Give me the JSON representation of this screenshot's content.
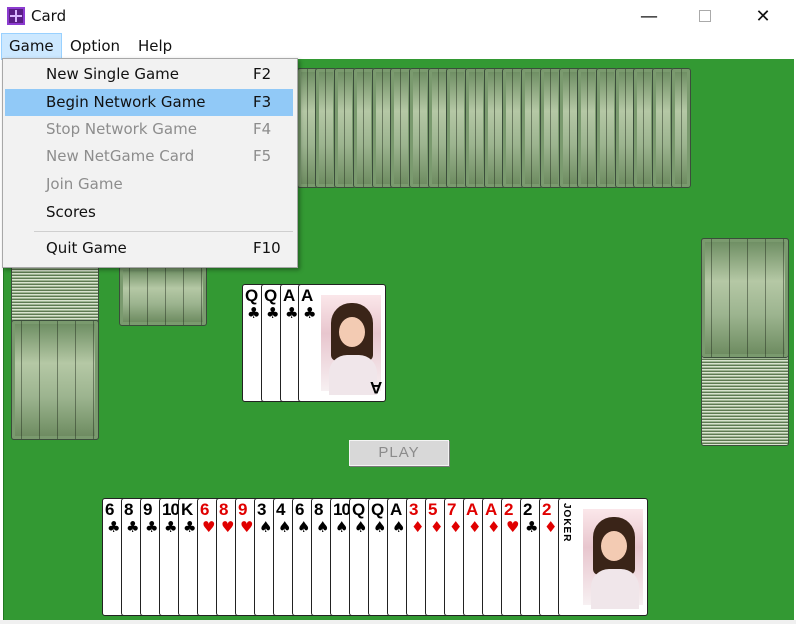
{
  "window": {
    "title": "Card",
    "controls": [
      "minimize-icon",
      "maximize-icon",
      "close-icon"
    ]
  },
  "menu": {
    "items": [
      "Game",
      "Option",
      "Help"
    ],
    "active": "Game",
    "dropdown": [
      {
        "label": "New Single Game",
        "shortcut": "F2",
        "state": "enabled"
      },
      {
        "label": "Begin Network Game",
        "shortcut": "F3",
        "state": "highlighted"
      },
      {
        "label": "Stop Network Game",
        "shortcut": "F4",
        "state": "disabled"
      },
      {
        "label": "New NetGame Card",
        "shortcut": "F5",
        "state": "disabled"
      },
      {
        "label": "Join Game",
        "shortcut": "",
        "state": "disabled"
      },
      {
        "label": "Scores",
        "shortcut": "",
        "state": "enabled"
      },
      {
        "label": "Quit Game",
        "shortcut": "F10",
        "state": "enabled"
      }
    ]
  },
  "table": {
    "background": "#339933"
  },
  "played_cards": [
    {
      "rank": "Q",
      "suit": "♣",
      "color": "black"
    },
    {
      "rank": "Q",
      "suit": "♣",
      "color": "black"
    },
    {
      "rank": "A",
      "suit": "♣",
      "color": "black"
    },
    {
      "rank": "A",
      "suit": "♣",
      "color": "black"
    }
  ],
  "play_button": {
    "label": "PLAY"
  },
  "hand": [
    {
      "rank": "6",
      "suit": "♣",
      "color": "black"
    },
    {
      "rank": "8",
      "suit": "♣",
      "color": "black"
    },
    {
      "rank": "9",
      "suit": "♣",
      "color": "black"
    },
    {
      "rank": "10",
      "suit": "♣",
      "color": "black"
    },
    {
      "rank": "K",
      "suit": "♣",
      "color": "black"
    },
    {
      "rank": "6",
      "suit": "♥",
      "color": "red"
    },
    {
      "rank": "8",
      "suit": "♥",
      "color": "red"
    },
    {
      "rank": "9",
      "suit": "♥",
      "color": "red"
    },
    {
      "rank": "3",
      "suit": "♠",
      "color": "black"
    },
    {
      "rank": "4",
      "suit": "♠",
      "color": "black"
    },
    {
      "rank": "6",
      "suit": "♠",
      "color": "black"
    },
    {
      "rank": "8",
      "suit": "♠",
      "color": "black"
    },
    {
      "rank": "10",
      "suit": "♠",
      "color": "black"
    },
    {
      "rank": "Q",
      "suit": "♠",
      "color": "black"
    },
    {
      "rank": "Q",
      "suit": "♠",
      "color": "black"
    },
    {
      "rank": "A",
      "suit": "♠",
      "color": "black"
    },
    {
      "rank": "3",
      "suit": "♦",
      "color": "red"
    },
    {
      "rank": "5",
      "suit": "♦",
      "color": "red"
    },
    {
      "rank": "7",
      "suit": "♦",
      "color": "red"
    },
    {
      "rank": "A",
      "suit": "♦",
      "color": "red"
    },
    {
      "rank": "A",
      "suit": "♦",
      "color": "red"
    },
    {
      "rank": "2",
      "suit": "♥",
      "color": "red"
    },
    {
      "rank": "2",
      "suit": "♣",
      "color": "black"
    },
    {
      "rank": "2",
      "suit": "♦",
      "color": "red"
    },
    {
      "rank": "JOKER",
      "suit": "",
      "color": "black"
    }
  ]
}
